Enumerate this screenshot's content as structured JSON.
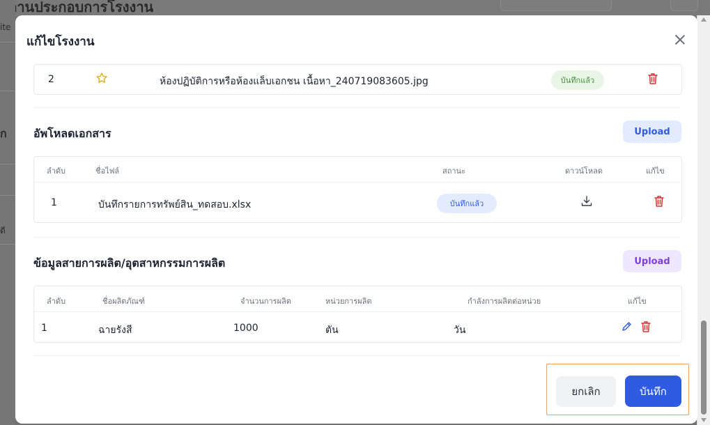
{
  "background": {
    "page_title_fragment": "สถานประกอบการโรงงาน",
    "side_fragments": [
      "ite",
      "ก",
      "ดี"
    ]
  },
  "modal": {
    "title": "แก้ไขโรงงาน",
    "close_icon": "close-icon",
    "images_table": {
      "rows": [
        {
          "no": "2",
          "favorite_icon": "star-outline-icon",
          "name": "ห้องปฏิบัติการหรือห้องแล็บเอกชน เนื้อหา_240719083605.jpg",
          "status": "บันทึกแล้ว",
          "delete_icon": "trash-icon"
        }
      ]
    },
    "documents": {
      "title": "อัพโหลดเอกสาร",
      "upload_label": "Upload",
      "headers": {
        "no": "ลำดับ",
        "file_name": "ชื่อไฟล์",
        "status": "สถานะ",
        "download": "ดาวน์โหลด",
        "edit": "แก้ไข"
      },
      "rows": [
        {
          "no": "1",
          "file_name": "บันทึกรายการทรัพย์สิน_ทดสอบ.xlsx",
          "status": "บันทึกแล้ว",
          "download_icon": "download-icon",
          "delete_icon": "trash-icon"
        }
      ]
    },
    "production": {
      "title": "ข้อมูลสายการผลิต/อุตสาหกรรมการผลิต",
      "upload_label": "Upload",
      "headers": {
        "no": "ลำดับ",
        "product_name": "ชื่อผลิตภัณฑ์",
        "quantity": "จำนวนการผลิต",
        "unit": "หน่วยการผลิต",
        "capacity": "กำลังการผลิตต่อหน่วย",
        "edit": "แก้ไข"
      },
      "rows": [
        {
          "no": "1",
          "product_name": "ฉายรังสี",
          "quantity": "1000",
          "unit": "ตัน",
          "capacity": "วัน",
          "edit_icon": "pencil-icon",
          "delete_icon": "trash-icon"
        }
      ]
    },
    "footer": {
      "cancel_label": "ยกเลิก",
      "save_label": "บันทึก"
    }
  },
  "colors": {
    "primary": "#2f5be3",
    "saved_badge_bg": "#e9f6e6",
    "saved_badge_text": "#3f8f3a",
    "saved_badge_blue_bg": "#e3ebff",
    "saved_badge_blue_text": "#2f5be3",
    "upload_blue_bg": "#e3ebff",
    "upload_purple_bg": "#efe7ff",
    "upload_purple_text": "#7b3fe4",
    "danger": "#d93030",
    "highlight": "#f0a060"
  }
}
